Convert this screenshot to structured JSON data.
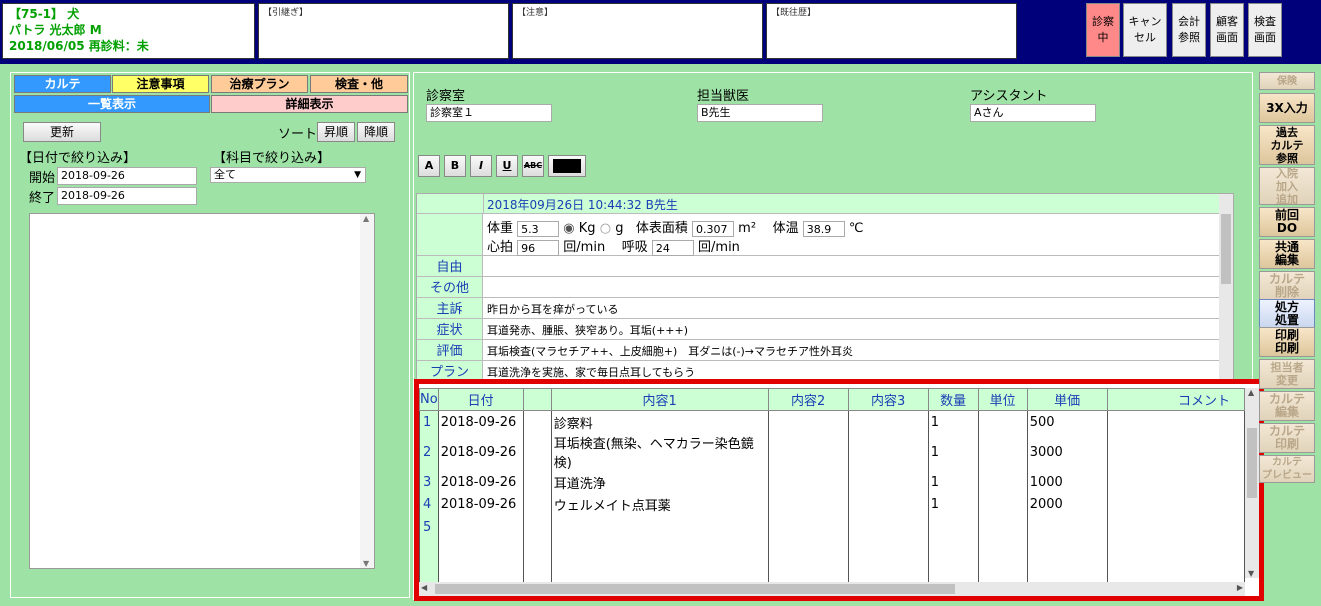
{
  "header": {
    "line1": "【75-1】 犬",
    "line2": "パトラ 光太郎 M",
    "line3": "2018/06/05 再診料：未",
    "box_handover": "【引継ぎ】",
    "box_caution": "【注意】",
    "box_history": "【既往歴】",
    "buttons": [
      "診察\n中",
      "キャン\nセル",
      "会計\n参照",
      "顧客\n画面",
      "検査\n画面"
    ]
  },
  "left": {
    "tabs": [
      "カルテ",
      "注意事項",
      "治療プラン",
      "検査・他"
    ],
    "tabs2": [
      "一覧表示",
      "詳細表示"
    ],
    "refresh": "更新",
    "sort_label": "ソート",
    "sort_asc": "昇順",
    "sort_desc": "降順",
    "date_filter": "【日付で絞り込み】",
    "subject_filter": "【科目で絞り込み】",
    "start_label": "開始",
    "start_value": "2018-09-26",
    "end_label": "終了",
    "end_value": "2018-09-26",
    "subject_value": "全て"
  },
  "main": {
    "room_label": "診察室",
    "room_value": "診察室１",
    "vet_label": "担当獣医",
    "vet_value": "B先生",
    "assistant_label": "アシスタント",
    "assistant_value": "Aさん",
    "format": [
      "A",
      "B",
      "I",
      "U",
      "ABC"
    ],
    "karte_header": "2018年09月26日 10:44:32 B先生",
    "vitals": {
      "weight_label": "体重",
      "weight": "5.3",
      "kg": "Kg",
      "g": "g",
      "bsa_label": "体表面積",
      "bsa": "0.307",
      "bsa_unit": "m²",
      "temp_label": "体温",
      "temp": "38.9",
      "temp_unit": "℃",
      "hr_label": "心拍",
      "hr": "96",
      "hr_unit": "回/min",
      "rr_label": "呼吸",
      "rr": "24",
      "rr_unit": "回/min"
    },
    "rows": [
      {
        "label": "自由",
        "value": ""
      },
      {
        "label": "その他",
        "value": ""
      },
      {
        "label": "主訴",
        "value": "昨日から耳を痒がっている"
      },
      {
        "label": "症状",
        "value": "耳道発赤、腫脹、狭窄あり。耳垢(+++)"
      },
      {
        "label": "評価",
        "value": "耳垢検査(マラセチア++、上皮細胞+)　耳ダニは(-)→マラセチア性外耳炎"
      },
      {
        "label": "プラン",
        "value": "耳道洗浄を実施、家で毎日点耳してもらう"
      }
    ],
    "table": {
      "headers": [
        "No",
        "日付",
        "",
        "内容1",
        "内容2",
        "内容3",
        "数量",
        "単位",
        "単価",
        "コメント"
      ],
      "rows": [
        [
          "1",
          "2018-09-26",
          "",
          "診察料",
          "",
          "",
          "1",
          "",
          "500",
          ""
        ],
        [
          "2",
          "2018-09-26",
          "",
          "耳垢検査(無染、ヘマカラー染色鏡検)",
          "",
          "",
          "1",
          "",
          "3000",
          ""
        ],
        [
          "3",
          "2018-09-26",
          "",
          "耳道洗浄",
          "",
          "",
          "1",
          "",
          "1000",
          ""
        ],
        [
          "4",
          "2018-09-26",
          "",
          "ウェルメイト点耳薬",
          "",
          "",
          "1",
          "",
          "2000",
          ""
        ],
        [
          "5",
          "",
          "",
          "",
          "",
          "",
          "",
          "",
          "",
          ""
        ],
        [
          "",
          "",
          "",
          "",
          "",
          "",
          "",
          "",
          "",
          ""
        ],
        [
          "",
          "",
          "",
          "",
          "",
          "",
          "",
          "",
          "",
          ""
        ]
      ]
    }
  },
  "side": [
    "保険",
    "3X入力",
    "過去\nカルテ\n参照",
    "入院\n加入\n追加",
    "前回\nDO",
    "共通\n編集",
    "カルテ\n削除",
    "処方\n処置",
    "印刷\n印刷",
    "担当者\n変更",
    "カルテ\n編集",
    "カルテ\n印刷",
    "カルテ\nプレビュー"
  ]
}
